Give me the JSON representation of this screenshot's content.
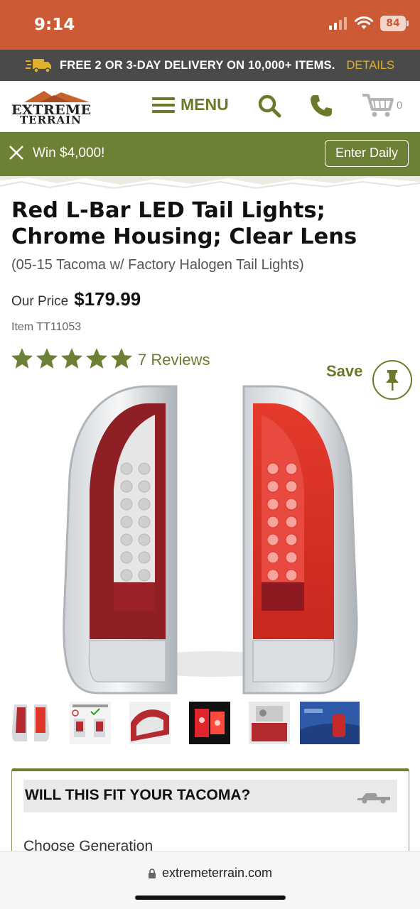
{
  "status_bar": {
    "time": "9:14",
    "battery": "84"
  },
  "promo": {
    "text": "FREE 2 OR 3-DAY DELIVERY ON 10,000+ ITEMS.",
    "link": "DETAILS",
    "icon": "truck-fast-icon"
  },
  "header": {
    "logo_line1": "EXTREME",
    "logo_line2": "TERRAIN",
    "menu_label": "MENU",
    "cart_count": "0"
  },
  "banner": {
    "text": "Win $4,000!",
    "button": "Enter Daily"
  },
  "product": {
    "title": "Red L-Bar LED Tail Lights; Chrome Housing; Clear Lens",
    "subtitle": "(05-15 Tacoma w/ Factory Halogen Tail Lights)",
    "price_label": "Our Price",
    "price": "$179.99",
    "item_number": "Item TT11053",
    "rating": 5,
    "reviews": "7 Reviews",
    "save_label": "Save"
  },
  "fitment": {
    "title": "WILL THIS FIT YOUR TACOMA?",
    "choose_label": "Choose Generation"
  },
  "browser": {
    "url": "extremeterrain.com"
  },
  "colors": {
    "brand_green": "#6c8135",
    "status_orange": "#cc5a35",
    "promo_gold": "#e1b02a"
  }
}
